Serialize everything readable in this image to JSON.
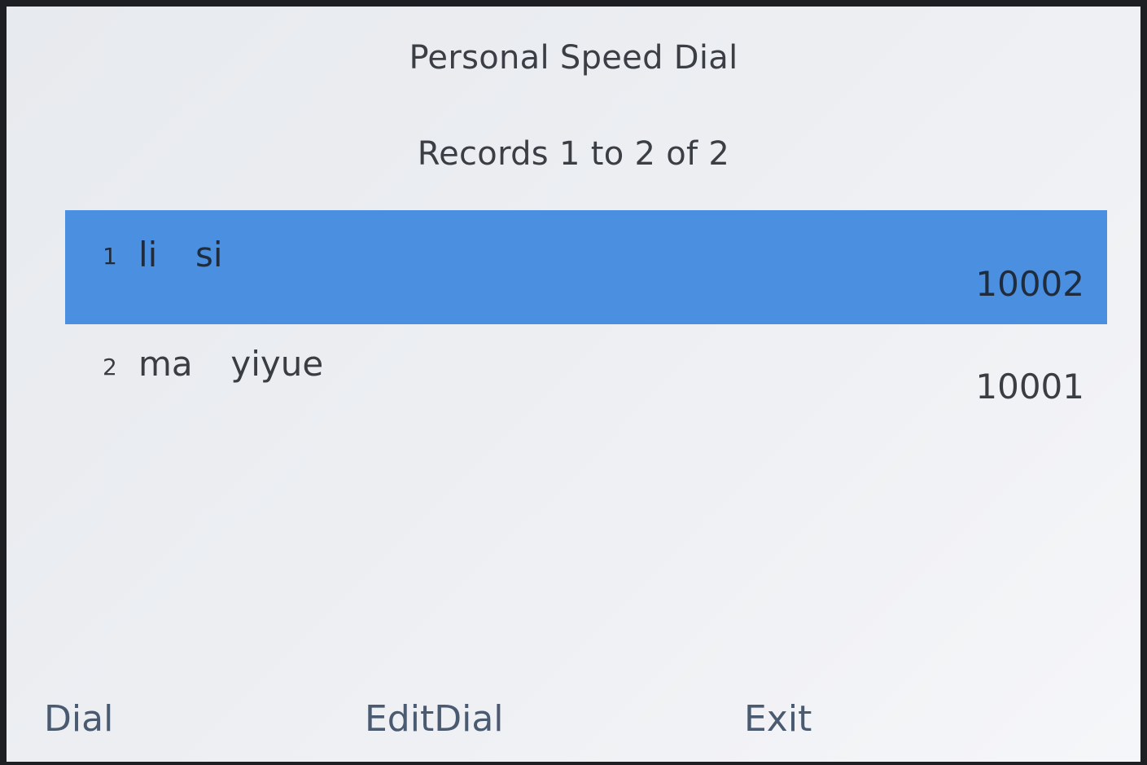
{
  "screen": {
    "title": "Personal Speed Dial",
    "records_status": "Records 1 to 2 of 2"
  },
  "entries": [
    {
      "index": "1",
      "name": "li  si",
      "number": "10002",
      "selected": true
    },
    {
      "index": "2",
      "name": "ma  yiyue",
      "number": "10001",
      "selected": false
    }
  ],
  "softkeys": [
    {
      "label": "Dial"
    },
    {
      "label": "EditDial"
    },
    {
      "label": "Exit"
    }
  ],
  "colors": {
    "selection": "#4a8fe0",
    "background": "#eceef2",
    "softkey_text": "#4a5a70"
  }
}
